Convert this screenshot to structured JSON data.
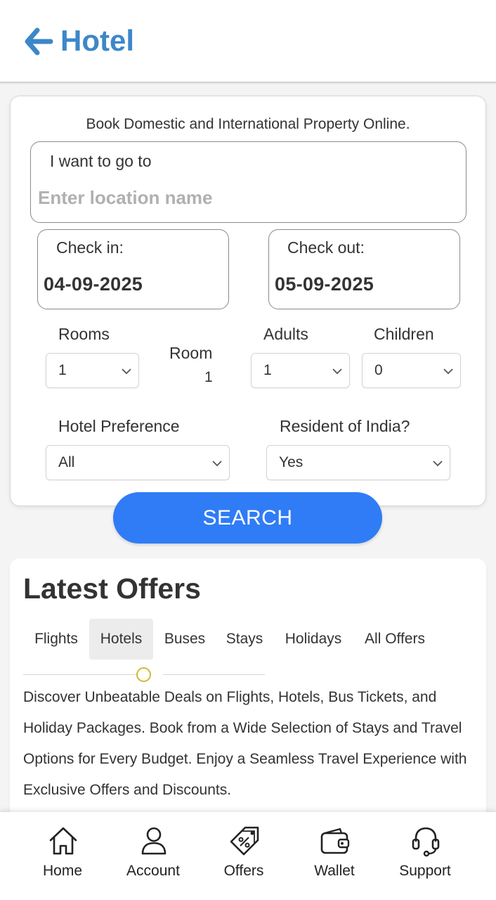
{
  "header": {
    "title": "Hotel"
  },
  "form": {
    "intro": "Book Domestic and International Property Online.",
    "location_label": "I want to go to",
    "location_placeholder": "Enter location name",
    "location_value": "",
    "check_in_label": "Check in:",
    "check_in_value": "04-09-2025",
    "check_out_label": "Check out:",
    "check_out_value": "05-09-2025",
    "rooms_label": "Rooms",
    "rooms_value": "1",
    "room_label": "Room",
    "room_count": "1",
    "adults_label": "Adults",
    "adults_value": "1",
    "children_label": "Children",
    "children_value": "0",
    "preference_label": "Hotel Preference",
    "preference_value": "All",
    "resident_label": "Resident of India?",
    "resident_value": "Yes",
    "search_label": "SEARCH"
  },
  "offers": {
    "title": "Latest Offers",
    "tabs": [
      "Flights",
      "Hotels",
      "Buses",
      "Stays",
      "Holidays",
      "All Offers"
    ],
    "active_tab": "Hotels",
    "description": "Discover Unbeatable Deals on Flights, Hotels, Bus Tickets, and Holiday Packages. Book from a Wide Selection of Stays and Travel Options for Every Budget. Enjoy a Seamless Travel Experience with Exclusive Offers and Discounts."
  },
  "nav": {
    "home": "Home",
    "account": "Account",
    "offers": "Offers",
    "wallet": "Wallet",
    "support": "Support"
  },
  "colors": {
    "brand": "#3d87c9",
    "search_button": "#2f7cf6",
    "indicator": "#d4b730"
  },
  "icons": {
    "back": "arrow-left-icon",
    "chevron": "chevron-down-icon",
    "home": "home-icon",
    "account": "user-icon",
    "offers": "tag-icon",
    "wallet": "wallet-icon",
    "support": "headset-icon"
  }
}
